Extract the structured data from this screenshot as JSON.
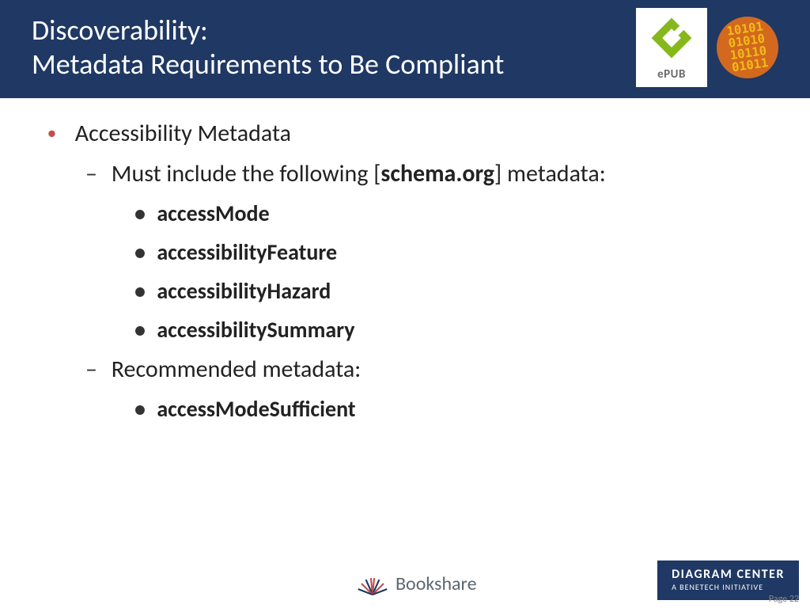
{
  "header": {
    "title_line1": "Discoverability:",
    "title_line2": "Metadata Requirements to Be Compliant",
    "epub_label": "ePUB"
  },
  "content": {
    "bullet1": "Accessibility Metadata",
    "sub1_prefix": "Must include the following [",
    "sub1_bold": "schema.org",
    "sub1_suffix": "] metadata:",
    "req": {
      "r1": "accessMode",
      "r2": "accessibilityFeature",
      "r3": "accessibilityHazard",
      "r4": "accessibilitySummary"
    },
    "sub2": "Recommended metadata:",
    "rec": {
      "r1": "accessModeSufficient"
    }
  },
  "footer": {
    "bookshare": "Bookshare",
    "diagram_title": "DIAGRAM CENTER",
    "diagram_sub": "A BENETECH INITIATIVE",
    "page": "Page 22"
  }
}
